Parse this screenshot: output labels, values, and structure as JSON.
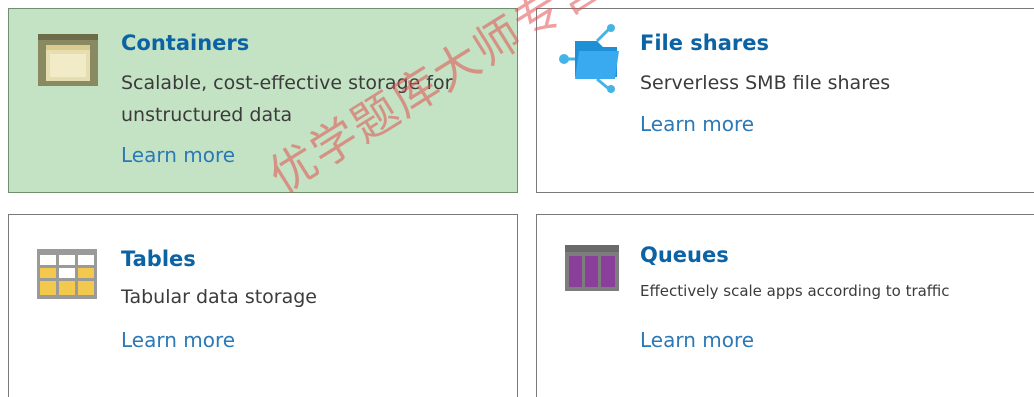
{
  "cards": [
    {
      "title": "Containers",
      "description": "Scalable, cost-effective storage for unstructured data",
      "link": "Learn more",
      "icon": "containers-icon",
      "selected": true
    },
    {
      "title": "File shares",
      "description": "Serverless SMB file shares",
      "link": "Learn more",
      "icon": "file-shares-icon",
      "selected": false
    },
    {
      "title": "Tables",
      "description": "Tabular data storage",
      "link": "Learn more",
      "icon": "tables-icon",
      "selected": false
    },
    {
      "title": "Queues",
      "description": "Effectively scale apps according to traffic",
      "link": "Learn more",
      "icon": "queues-icon",
      "selected": false
    }
  ],
  "watermark": "优学题库大师专营",
  "colors": {
    "selected_background": "#c4e3c4",
    "title": "#0c63a4",
    "link": "#2c79b8",
    "watermark": "#e05050"
  }
}
